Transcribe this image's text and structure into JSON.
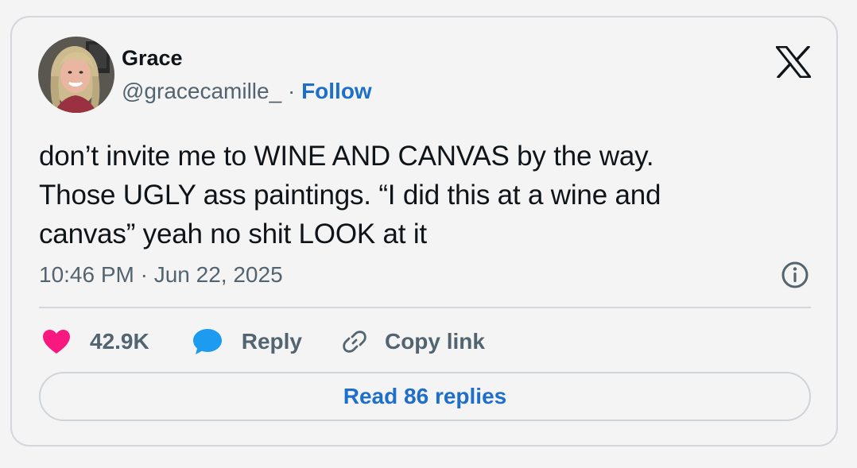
{
  "author": {
    "name": "Grace",
    "handle": "@gracecamille_",
    "separator": "·",
    "follow_label": "Follow"
  },
  "tweet": {
    "lines": [
      "don’t invite me to WINE AND CANVAS by the way.",
      "Those UGLY ass paintings. “I did this at a wine and",
      "canvas” yeah no shit LOOK at it"
    ],
    "timestamp": "10:46 PM · Jun 22, 2025"
  },
  "actions": {
    "like_count": "42.9K",
    "reply_label": "Reply",
    "copy_link_label": "Copy link"
  },
  "read_replies_label": "Read 86 replies",
  "icons": {
    "brand": "x-logo-icon",
    "info": "info-icon",
    "like": "heart-icon",
    "reply": "speech-bubble-icon",
    "copy": "link-icon"
  },
  "colors": {
    "accent": "#1d6fc9",
    "heart": "#f91880",
    "reply_bubble": "#1d9bf0",
    "text": "#0f1419",
    "muted": "#536471"
  }
}
